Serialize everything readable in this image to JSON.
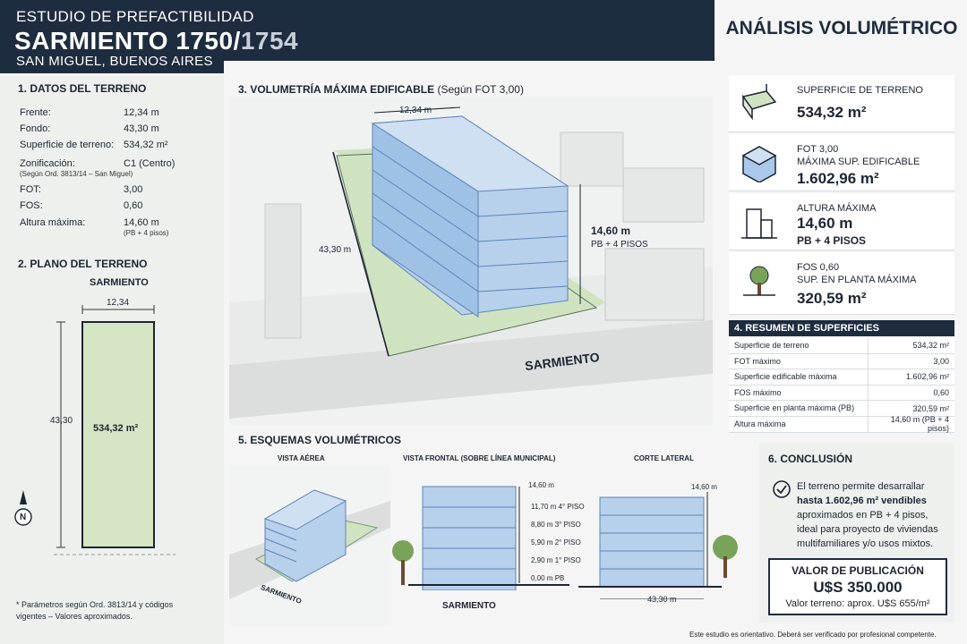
{
  "header": {
    "kicker": "ESTUDIO DE PREFACTIBILIDAD",
    "title_main": "SARMIENTO 1750/",
    "title_dim": "1754",
    "location": "SAN MIGUEL, BUENOS AIRES"
  },
  "right_title": "ANÁLISIS VOLUMÉTRICO",
  "s1": {
    "title": "1. DATOS DEL TERRENO",
    "rows": [
      {
        "k": "Frente:",
        "v": "12,34 m"
      },
      {
        "k": "Fondo:",
        "v": "43,30 m"
      },
      {
        "k": "Superficie de terreno:",
        "v": "534,32 m²"
      },
      {
        "k": "Zonificación:",
        "v": "C1 (Centro)",
        "note": "(Según Ord. 3813/14 – San Miguel)"
      },
      {
        "k": "FOT:",
        "v": "3,00"
      },
      {
        "k": "FOS:",
        "v": "0,60"
      },
      {
        "k": "Altura máxima:",
        "v": "14,60 m",
        "note2": "(PB + 4 pisos)"
      }
    ]
  },
  "s2": {
    "title": "2. PLANO DEL TERRENO",
    "street": "SARMIENTO",
    "front": "12,34",
    "depth": "43,30",
    "area": "534,32 m²",
    "north": "N"
  },
  "footnote": "* Parámetros según Ord. 3813/14 y códigos vigentes – Valores aproximados.",
  "s3": {
    "title": "3. VOLUMETRÍA MÁXIMA EDIFICABLE",
    "title_note": "(Según FOT 3,00)",
    "front": "12,34 m",
    "depth": "43,30 m",
    "height": "14,60 m",
    "floors": "PB + 4 PISOS",
    "street": "SARMIENTO"
  },
  "s5": {
    "title": "5. ESQUEMAS VOLUMÉTRICOS",
    "aerial": "VISTA AÉREA",
    "frontal": "VISTA FRONTAL (SOBRE LÍNEA MUNICIPAL)",
    "lateral": "CORTE LATERAL",
    "street": "SARMIENTO",
    "street2": "SARMIENTO",
    "levels": [
      {
        "h": "14,60 m",
        "n": ""
      },
      {
        "h": "11,70 m",
        "n": "4° PISO"
      },
      {
        "h": "8,80 m",
        "n": "3° PISO"
      },
      {
        "h": "5,90 m",
        "n": "2° PISO"
      },
      {
        "h": "2,90 m",
        "n": "1° PISO"
      },
      {
        "h": "0,00 m",
        "n": "PB"
      }
    ],
    "lateral_h": "14,60 m",
    "lateral_len": "43,30 m"
  },
  "cards": [
    {
      "lbl1": "SUPERFICIE DE TERRENO",
      "lbl2": "",
      "big": "534,32 m²",
      "icon": "land-icon"
    },
    {
      "lbl1": "FOT 3,00",
      "lbl2": "MÁXIMA SUP. EDIFICABLE",
      "big": "1.602,96 m²",
      "icon": "cube-icon"
    },
    {
      "lbl1": "ALTURA MÁXIMA",
      "lbl2": "",
      "big": "14,60 m",
      "big2": "PB + 4 PISOS",
      "icon": "building-icon"
    },
    {
      "lbl1": "FOS 0,60",
      "lbl2": "SUP. EN PLANTA MÁXIMA",
      "big": "320,59 m²",
      "icon": "tree-icon"
    }
  ],
  "s4": {
    "title": "4. RESUMEN DE SUPERFICIES",
    "rows": [
      {
        "k": "Superficie de terreno",
        "v": "534,32 m²"
      },
      {
        "k": "FOT máximo",
        "v": "3,00"
      },
      {
        "k": "Superficie edificable máxima",
        "v": "1.602,96 m²"
      },
      {
        "k": "FOS máximo",
        "v": "0,60"
      },
      {
        "k": "Superficie en planta máxima (PB)",
        "v": "320,59 m²"
      },
      {
        "k": "Altura máxima",
        "v": "14,60 m (PB + 4 pisos)"
      }
    ]
  },
  "s6": {
    "title": "6. CONCLUSIÓN",
    "l1": "El terreno permite desarrallar",
    "l2": "hasta 1.602,96 m² vendibles",
    "l3": "aproximados en PB + 4 pisos,",
    "l4": "ideal para proyecto de viviendas",
    "l5": "multifamiliares y/o usos mixtos.",
    "val_title": "VALOR DE PUBLICACIÓN",
    "val": "U$S 350.000",
    "val_note": "Valor terreno: aprox. U$S 655/m²"
  },
  "disclaimer": "Este estudio es orientativo. Deberá ser verificado por profesional competente."
}
